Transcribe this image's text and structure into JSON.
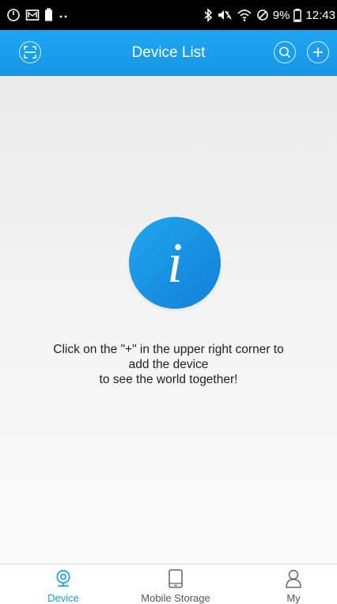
{
  "status_bar": {
    "battery": "9%",
    "time": "12:43",
    "left_icons": [
      "power-icon",
      "mail-icon",
      "battery-small-icon",
      "dots-icon"
    ],
    "right_icons": [
      "bluetooth-icon",
      "mute-icon",
      "wifi-icon",
      "dnd-icon",
      "battery-icon"
    ]
  },
  "header": {
    "title": "Device List",
    "left_icon": "scan-icon",
    "right_icons": [
      "search-icon",
      "add-icon"
    ]
  },
  "empty_state": {
    "icon": "info-icon",
    "line1": "Click on the \"+\" in the upper right corner to",
    "line2": "add the device",
    "line3": "to see the world together!"
  },
  "tabs": [
    {
      "label": "Device",
      "icon": "camera-icon",
      "active": true
    },
    {
      "label": "Mobile Storage",
      "icon": "tablet-icon",
      "active": false
    },
    {
      "label": "My",
      "icon": "user-icon",
      "active": false
    }
  ],
  "colors": {
    "accent": "#1a9ceb",
    "header": "#1ea6f2",
    "active_tab": "#1a9ceb",
    "inactive_tab": "#555555"
  }
}
